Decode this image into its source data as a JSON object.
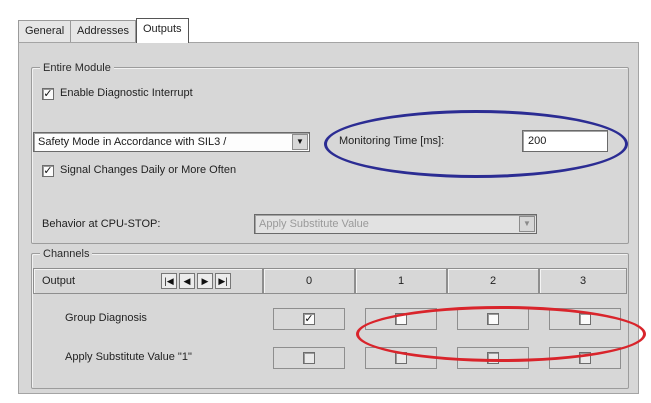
{
  "tabs": [
    "General",
    "Addresses",
    "Outputs"
  ],
  "entire_module": {
    "title": "Entire Module",
    "enable_diagnostic_interrupt": {
      "label": "Enable Diagnostic Interrupt",
      "checked": true
    },
    "safety_mode": {
      "value": "Safety Mode in Accordance with SIL3 / ",
      "arrow": "▼"
    },
    "monitoring_time": {
      "label": "Monitoring Time [ms]:",
      "value": "200"
    },
    "signal_changes": {
      "label": "Signal Changes Daily or More Often",
      "checked": true
    },
    "behavior_cpu_stop": {
      "label": "Behavior at CPU-STOP:",
      "value": "Apply Substitute Value",
      "arrow": "▼"
    }
  },
  "channels": {
    "title": "Channels",
    "header_label": "Output",
    "nav": [
      "|◀",
      "◀",
      "▶",
      "▶|"
    ],
    "columns": [
      "0",
      "1",
      "2",
      "3"
    ],
    "rows": [
      {
        "label": "Group Diagnosis",
        "checks": [
          true,
          false,
          false,
          false
        ]
      },
      {
        "label": "Apply Substitute Value \"1\"",
        "checks": [
          false,
          false,
          false,
          false
        ]
      }
    ]
  },
  "check_mark": "✓",
  "highlight_colors": {
    "monitoring": "#2b2c93",
    "group_diagnosis": "#d9242b"
  }
}
